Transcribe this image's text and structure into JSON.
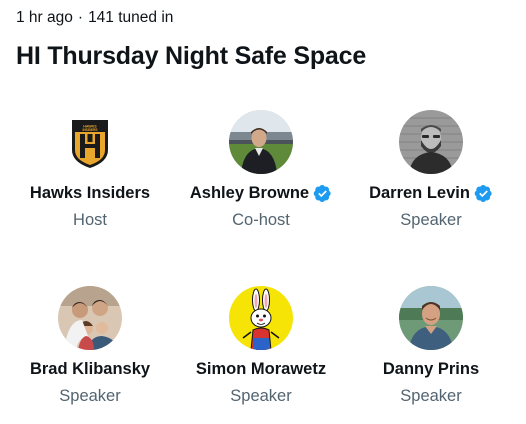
{
  "space": {
    "time_ago": "1 hr ago",
    "separator": "·",
    "tuned_in": "141 tuned in",
    "title": "HI Thursday Night Safe Space"
  },
  "colors": {
    "verified_blue": "#1d9bf0",
    "secondary_text": "#536471",
    "primary_text": "#0f1419",
    "logo_gold": "#e8a62c"
  },
  "participants": [
    {
      "name": "Hawks Insiders",
      "role": "Host",
      "verified": false,
      "avatar": "hawks-insiders-logo",
      "logo_text": "HAWKS INSIDERS"
    },
    {
      "name": "Ashley Browne",
      "role": "Co-host",
      "verified": true,
      "avatar": "photo-stadium"
    },
    {
      "name": "Darren Levin",
      "role": "Speaker",
      "verified": true,
      "avatar": "photo-brick-wall"
    },
    {
      "name": "Brad Klibansky",
      "role": "Speaker",
      "verified": false,
      "avatar": "photo-family"
    },
    {
      "name": "Simon Morawetz",
      "role": "Speaker",
      "verified": false,
      "avatar": "cartoon-rabbit"
    },
    {
      "name": "Danny Prins",
      "role": "Speaker",
      "verified": false,
      "avatar": "photo-outdoor"
    }
  ]
}
